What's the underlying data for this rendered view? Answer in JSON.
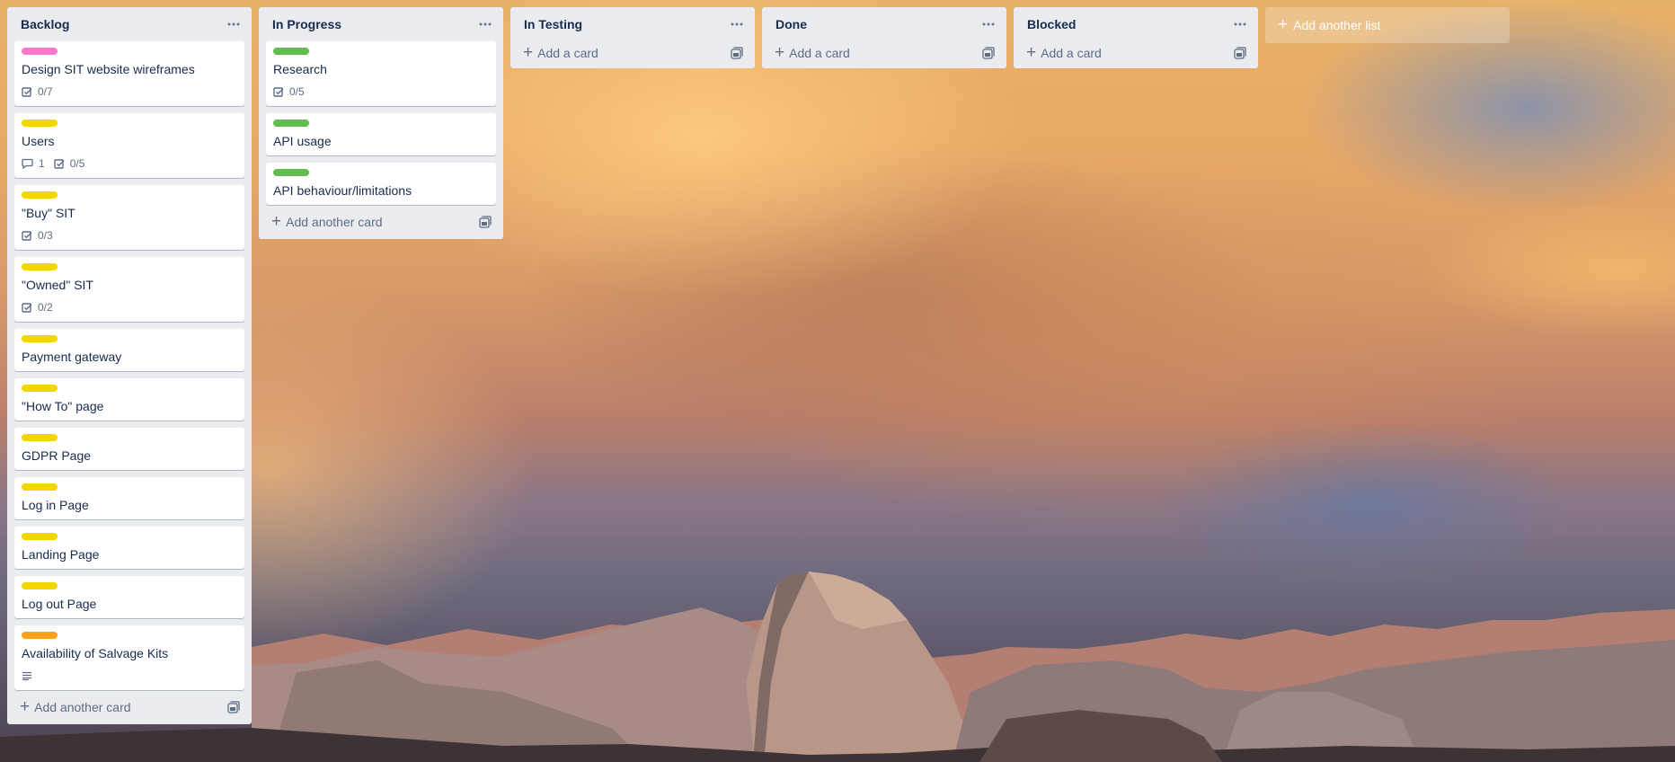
{
  "board": {
    "lists": [
      {
        "title": "Backlog",
        "cards": [
          {
            "label_color": "#ff78cb",
            "title": "Design SIT website wireframes",
            "checklist": "0/7"
          },
          {
            "label_color": "#f2d600",
            "title": "Users",
            "comments": "1",
            "checklist": "0/5"
          },
          {
            "label_color": "#f2d600",
            "title": "\"Buy\" SIT",
            "checklist": "0/3"
          },
          {
            "label_color": "#f2d600",
            "title": "\"Owned\" SIT",
            "checklist": "0/2"
          },
          {
            "label_color": "#f2d600",
            "title": "Payment gateway"
          },
          {
            "label_color": "#f2d600",
            "title": "\"How To\" page"
          },
          {
            "label_color": "#f2d600",
            "title": "GDPR Page"
          },
          {
            "label_color": "#f2d600",
            "title": "Log in Page"
          },
          {
            "label_color": "#f2d600",
            "title": "Landing Page"
          },
          {
            "label_color": "#f2d600",
            "title": "Log out Page"
          },
          {
            "label_color": "#ff9f1a",
            "title": "Availability of Salvage Kits",
            "has_description": true
          }
        ],
        "add_label": "Add another card"
      },
      {
        "title": "In Progress",
        "cards": [
          {
            "label_color": "#61bd4f",
            "title": "Research",
            "checklist": "0/5"
          },
          {
            "label_color": "#61bd4f",
            "title": "API usage"
          },
          {
            "label_color": "#61bd4f",
            "title": "API behaviour/limitations"
          }
        ],
        "add_label": "Add another card"
      },
      {
        "title": "In Testing",
        "cards": [],
        "add_label": "Add a card"
      },
      {
        "title": "Done",
        "cards": [],
        "add_label": "Add a card"
      },
      {
        "title": "Blocked",
        "cards": [],
        "add_label": "Add a card"
      }
    ],
    "add_list_label": "Add another list",
    "list_menu_glyph": "···",
    "add_glyph": "+"
  },
  "icons": {
    "list_menu": "more-horizontal-icon",
    "checklist": "checkbox-icon",
    "comment": "speech-bubble-icon",
    "description": "lines-description-icon",
    "template": "card-template-icon",
    "add": "plus-icon"
  },
  "colors": {
    "list_bg": "#ebecf0",
    "text": "#172b4d",
    "muted": "#5e6c84",
    "label_pink": "#ff78cb",
    "label_yellow": "#f2d600",
    "label_orange": "#ff9f1a",
    "label_green": "#61bd4f"
  }
}
